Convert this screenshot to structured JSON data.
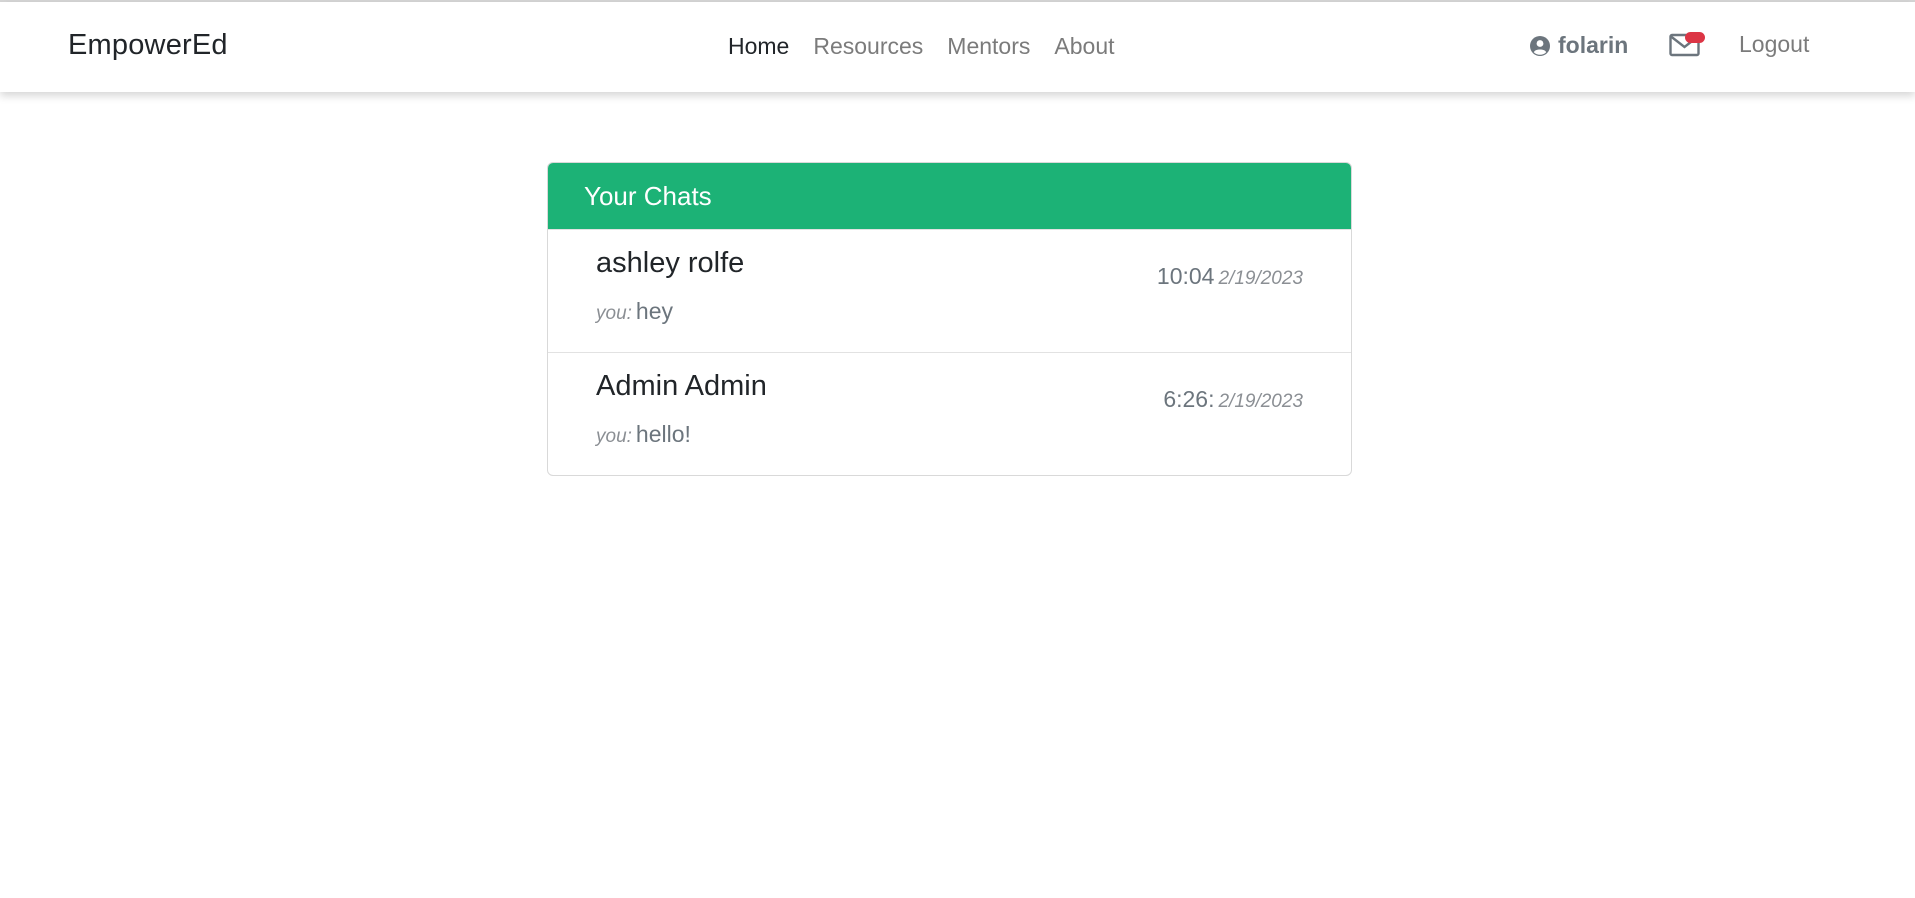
{
  "navbar": {
    "brand": "EmpowerEd",
    "links": [
      {
        "label": "Home",
        "active": true
      },
      {
        "label": "Resources",
        "active": false
      },
      {
        "label": "Mentors",
        "active": false
      },
      {
        "label": "About",
        "active": false
      }
    ],
    "user": {
      "name": "folarin",
      "icon": "user-circle-icon"
    },
    "mail": {
      "icon": "envelope-icon",
      "has_notification": true
    },
    "logout_label": "Logout"
  },
  "chats": {
    "header": "Your Chats",
    "items": [
      {
        "name": "ashley rolfe",
        "preview_prefix": "you:",
        "preview": "hey",
        "time": "10:04",
        "date": "2/19/2023"
      },
      {
        "name": "Admin Admin",
        "preview_prefix": "you:",
        "preview": "hello!",
        "time": "6:26:",
        "date": "2/19/2023"
      }
    ]
  },
  "colors": {
    "accent": "#1cb276",
    "notification": "#dc3545"
  }
}
